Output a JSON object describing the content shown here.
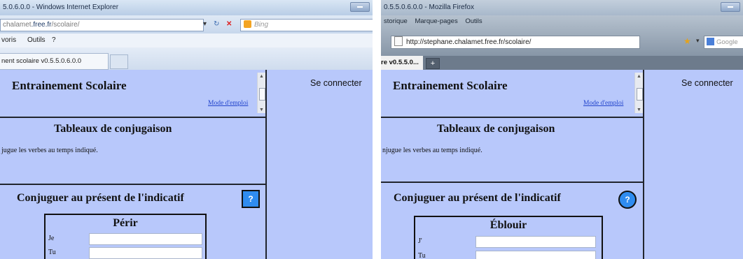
{
  "ie": {
    "window_title": "5.0.6.0.0 - Windows Internet Explorer",
    "address_domain": "chalamet",
    "address_host": ".free.fr",
    "address_path": "/scolaire/",
    "search_placeholder": "Bing",
    "menus": [
      "voris",
      "Outils",
      "?"
    ],
    "tab_title": "nent scolaire v0.5.5.0.6.0.0",
    "nav_glyphs": {
      "dropdown": "▾",
      "refresh": "↻",
      "stop": "✕"
    }
  },
  "firefox": {
    "window_title": "0.5.5.0.6.0.0 - Mozilla Firefox",
    "menus": [
      "storique",
      "Marque-pages",
      "Outils"
    ],
    "address": "http://stephane.chalamet.free.fr/scolaire/",
    "search_placeholder": "Google",
    "tab_title": "re v0.5.5.0...",
    "new_tab": "+"
  },
  "page": {
    "app_title": "Entrainement Scolaire",
    "mode_link": "Mode d'emploi",
    "connect": "Se connecter",
    "section_title": "Tableaux de conjugaison",
    "instruction": "njugue les verbes au temps indiqué.",
    "instruction_ie": "jugue les verbes au temps indiqué.",
    "exercise_title": "Conjuguer au présent de l'indicatif",
    "help_label": "?"
  },
  "ie_exercise": {
    "verb": "Périr",
    "pronouns": [
      "Je",
      "Tu"
    ]
  },
  "ff_exercise": {
    "verb": "Éblouir",
    "pronouns": [
      "J'",
      "Tu"
    ]
  },
  "colors": {
    "page_bg": "#b8c8fb",
    "help_button": "#2f8cf0",
    "link": "#2244cc",
    "divider": "#21252d"
  },
  "icons": [
    "search-icon",
    "refresh-icon",
    "stop-icon",
    "bing-icon",
    "page-icon",
    "star-icon",
    "google-icon",
    "scroll-up-icon",
    "scroll-down-icon",
    "minimize-icon"
  ]
}
